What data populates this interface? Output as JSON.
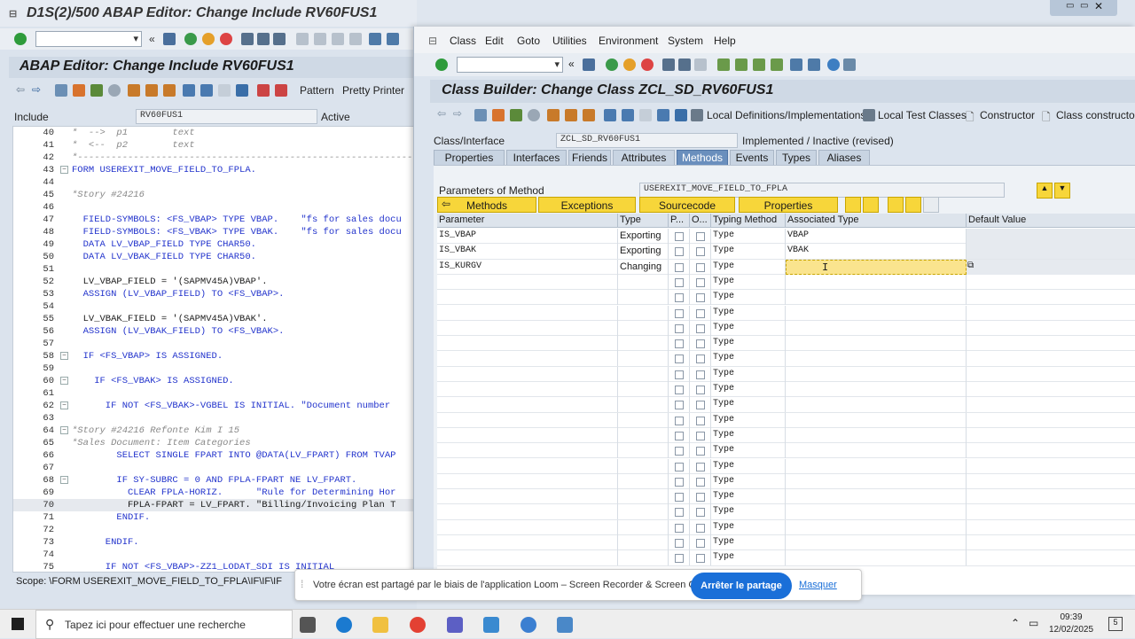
{
  "back": {
    "title": "D1S(2)/500 ABAP Editor: Change Include RV60FUS1",
    "header": "ABAP Editor: Change Include RV60FUS1",
    "pattern": "Pattern",
    "pretty": "Pretty Printer",
    "include_label": "Include",
    "include_value": "RV60FUS1",
    "status": "Active",
    "scope": "Scope: \\FORM USEREXIT_MOVE_FIELD_TO_FPLA\\IF\\IF\\IF",
    "code": [
      {
        "n": "40",
        "t": "*  -->  p1        text"
      },
      {
        "n": "41",
        "t": "*  <--  p2        text"
      },
      {
        "n": "42",
        "t": "*-------------------------------------------------------------"
      },
      {
        "n": "43",
        "t": "FORM USEREXIT_MOVE_FIELD_TO_FPLA."
      },
      {
        "n": "44",
        "t": ""
      },
      {
        "n": "45",
        "t": "*Story #24216"
      },
      {
        "n": "46",
        "t": ""
      },
      {
        "n": "47",
        "t": "  FIELD-SYMBOLS: <FS_VBAP> TYPE VBAP.    \"fs for sales docu"
      },
      {
        "n": "48",
        "t": "  FIELD-SYMBOLS: <FS_VBAK> TYPE VBAK.    \"fs for sales docu"
      },
      {
        "n": "49",
        "t": "  DATA LV_VBAP_FIELD TYPE CHAR50."
      },
      {
        "n": "50",
        "t": "  DATA LV_VBAK_FIELD TYPE CHAR50."
      },
      {
        "n": "51",
        "t": ""
      },
      {
        "n": "52",
        "t": "  LV_VBAP_FIELD = '(SAPMV45A)VBAP'."
      },
      {
        "n": "53",
        "t": "  ASSIGN (LV_VBAP_FIELD) TO <FS_VBAP>."
      },
      {
        "n": "54",
        "t": ""
      },
      {
        "n": "55",
        "t": "  LV_VBAK_FIELD = '(SAPMV45A)VBAK'."
      },
      {
        "n": "56",
        "t": "  ASSIGN (LV_VBAK_FIELD) TO <FS_VBAK>."
      },
      {
        "n": "57",
        "t": ""
      },
      {
        "n": "58",
        "t": "  IF <FS_VBAP> IS ASSIGNED."
      },
      {
        "n": "59",
        "t": ""
      },
      {
        "n": "60",
        "t": "    IF <FS_VBAK> IS ASSIGNED."
      },
      {
        "n": "61",
        "t": ""
      },
      {
        "n": "62",
        "t": "      IF NOT <FS_VBAK>-VGBEL IS INITIAL. \"Document number"
      },
      {
        "n": "63",
        "t": ""
      },
      {
        "n": "64",
        "t": "*Story #24216 Refonte Kim I 15"
      },
      {
        "n": "65",
        "t": "*Sales Document: Item Categories"
      },
      {
        "n": "66",
        "t": "        SELECT SINGLE FPART INTO @DATA(LV_FPART) FROM TVAP"
      },
      {
        "n": "67",
        "t": ""
      },
      {
        "n": "68",
        "t": "        IF SY-SUBRC = 0 AND FPLA-FPART NE LV_FPART."
      },
      {
        "n": "69",
        "t": "          CLEAR FPLA-HORIZ.      \"Rule for Determining Hor"
      },
      {
        "n": "70",
        "t": "          FPLA-FPART = LV_FPART. \"Billing/Invoicing Plan T"
      },
      {
        "n": "71",
        "t": "        ENDIF."
      },
      {
        "n": "72",
        "t": ""
      },
      {
        "n": "73",
        "t": "      ENDIF."
      },
      {
        "n": "74",
        "t": ""
      },
      {
        "n": "75",
        "t": "      IF NOT <FS_VBAP>-ZZ1_LODAT_SDI IS INITIAL"
      }
    ]
  },
  "front": {
    "menu": [
      "Class",
      "Edit",
      "Goto",
      "Utilities",
      "Environment",
      "System",
      "Help"
    ],
    "header": "Class Builder: Change Class ZCL_SD_RV60FUS1",
    "apptb": {
      "local_defs": "Local Definitions/Implementations",
      "local_test": "Local Test Classes",
      "constructor": "Constructor",
      "class_constructor": "Class constructor"
    },
    "ci_label": "Class/Interface",
    "ci_value": "ZCL_SD_RV60FUS1",
    "ci_status": "Implemented / Inactive (revised)",
    "tabs": [
      "Properties",
      "Interfaces",
      "Friends",
      "Attributes",
      "Methods",
      "Events",
      "Types",
      "Aliases"
    ],
    "pm_label": "Parameters of Method",
    "pm_value": "USEREXIT_MOVE_FIELD_TO_FPLA",
    "buttons": {
      "methods": "Methods",
      "exceptions": "Exceptions",
      "sourcecode": "Sourcecode",
      "properties": "Properties"
    },
    "cols": [
      "Parameter",
      "Type",
      "P...",
      "O...",
      "Typing Method",
      "Associated Type",
      "Default Value"
    ],
    "rows": [
      {
        "p": "IS_VBAP",
        "t": "Exporting",
        "tm": "Type",
        "at": "VBAP"
      },
      {
        "p": "IS_VBAK",
        "t": "Exporting",
        "tm": "Type",
        "at": "VBAK"
      },
      {
        "p": "IS_KURGV",
        "t": "Changing",
        "tm": "Type",
        "at": ""
      }
    ],
    "empty_type": "Type"
  },
  "loom": {
    "msg": "Votre écran est partagé par le biais de l'application Loom – Screen Recorder & Screen Capture.",
    "stop": "Arrêter le partage",
    "hide": "Masquer"
  },
  "taskbar": {
    "search": "Tapez ici pour effectuer une recherche",
    "time": "09:39",
    "date": "12/02/2025",
    "badge": "5"
  }
}
